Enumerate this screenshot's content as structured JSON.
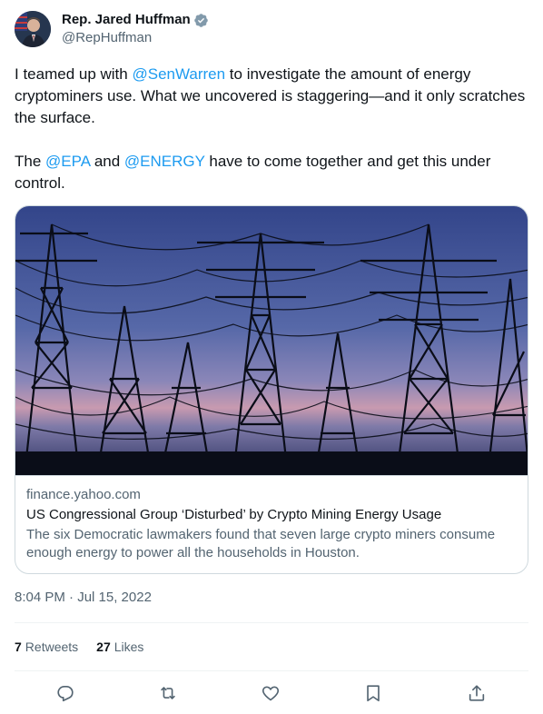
{
  "author": {
    "display_name": "Rep. Jared Huffman",
    "handle": "@RepHuffman",
    "verified": true
  },
  "tweet": {
    "para1": [
      {
        "text": "I teamed up with ",
        "type": "text"
      },
      {
        "text": "@SenWarren",
        "type": "mention"
      },
      {
        "text": " to investigate the amount of energy cryptominers use. What we uncovered is staggering—and it only scratches the surface.",
        "type": "text"
      }
    ],
    "para2": [
      {
        "text": "The ",
        "type": "text"
      },
      {
        "text": "@EPA",
        "type": "mention"
      },
      {
        "text": " and ",
        "type": "text"
      },
      {
        "text": "@ENERGY",
        "type": "mention"
      },
      {
        "text": " have to come together and get this under control.",
        "type": "text"
      }
    ]
  },
  "card": {
    "domain": "finance.yahoo.com",
    "title": "US Congressional Group ‘Disturbed’ by Crypto Mining Energy Usage",
    "description": "The six Democratic lawmakers found that seven large crypto miners consume enough energy to power all the households in Houston."
  },
  "timestamp": "8:04 PM · Jul 15, 2022",
  "stats": {
    "retweets_count": "7",
    "retweets_label": "Retweets",
    "likes_count": "27",
    "likes_label": "Likes"
  },
  "actions": [
    "reply-icon",
    "retweet-icon",
    "like-icon",
    "bookmark-icon",
    "share-icon"
  ],
  "colors": {
    "link": "#1d9bf0",
    "secondary_text": "#536471",
    "border": "#cfd9de"
  }
}
